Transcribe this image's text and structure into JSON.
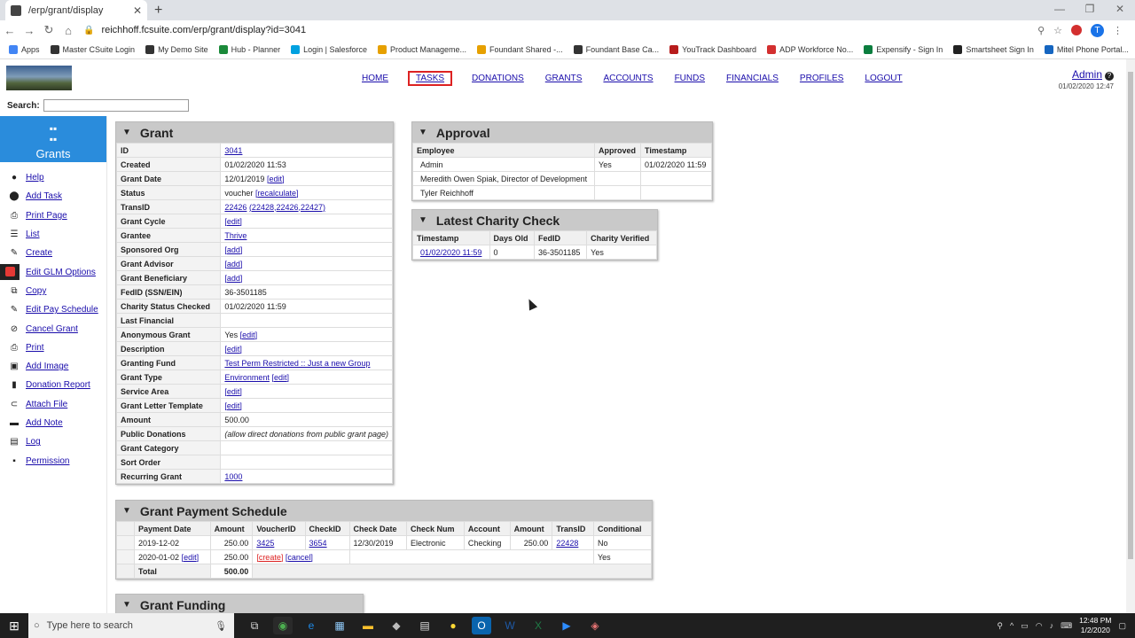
{
  "browser": {
    "tab_title": "/erp/grant/display",
    "url": "reichhoff.fcsuite.com/erp/grant/display?id=3041",
    "profile_initial": "T",
    "bookmarks": [
      "Apps",
      "Master CSuite Login",
      "My Demo Site",
      "Hub - Planner",
      "Login | Salesforce",
      "Product Manageme...",
      "Foundant Shared -...",
      "Foundant Base Ca...",
      "YouTrack Dashboard",
      "ADP Workforce No...",
      "Expensify - Sign In",
      "Smartsheet Sign In",
      "Mitel Phone Portal..."
    ]
  },
  "nav": {
    "items": [
      "HOME",
      "TASKS",
      "DONATIONS",
      "GRANTS",
      "ACCOUNTS",
      "FUNDS",
      "FINANCIALS",
      "PROFILES",
      "LOGOUT"
    ],
    "selected": "TASKS"
  },
  "user": {
    "name": "Admin",
    "datetime": "01/02/2020 12:47"
  },
  "search": {
    "label": "Search:",
    "value": ""
  },
  "sidebar": {
    "title": "Grants",
    "items": [
      {
        "label": "Help",
        "icon": "question-icon"
      },
      {
        "label": "Add Task",
        "icon": "task-icon"
      },
      {
        "label": "Print Page",
        "icon": "printer-icon"
      },
      {
        "label": "List",
        "icon": "list-icon"
      },
      {
        "label": "Create",
        "icon": "pencil-icon"
      },
      {
        "label": "Edit GLM Options",
        "icon": "red-square-icon"
      },
      {
        "label": "Copy",
        "icon": "copy-icon"
      },
      {
        "label": "Edit Pay Schedule",
        "icon": "edit-icon"
      },
      {
        "label": "Cancel Grant",
        "icon": "cancel-icon"
      },
      {
        "label": "Print",
        "icon": "printer-icon"
      },
      {
        "label": "Add Image",
        "icon": "image-icon"
      },
      {
        "label": "Donation Report",
        "icon": "bar-chart-icon"
      },
      {
        "label": "Attach File",
        "icon": "paperclip-icon"
      },
      {
        "label": "Add Note",
        "icon": "note-icon"
      },
      {
        "label": "Log",
        "icon": "log-icon"
      },
      {
        "label": "Permission",
        "icon": "lock-icon"
      }
    ]
  },
  "grant": {
    "title": "Grant",
    "rows": [
      {
        "label": "ID",
        "value": "3041",
        "link": true
      },
      {
        "label": "Created",
        "value": "01/02/2020 11:53"
      },
      {
        "label": "Grant Date",
        "value": "12/01/2019",
        "action": "[edit]"
      },
      {
        "label": "Status",
        "value": "voucher",
        "action": "[recalculate]"
      },
      {
        "label": "TransID",
        "value": "22426",
        "link": true,
        "extra": "(22428,22426,22427)"
      },
      {
        "label": "Grant Cycle",
        "value": "",
        "action": "[edit]"
      },
      {
        "label": "Grantee",
        "value": "Thrive",
        "link": true
      },
      {
        "label": "Sponsored Org",
        "value": "",
        "action": "[add]"
      },
      {
        "label": "Grant Advisor",
        "value": "",
        "action": "[add]"
      },
      {
        "label": "Grant Beneficiary",
        "value": "",
        "action": "[add]"
      },
      {
        "label": "FedID (SSN/EIN)",
        "value": "36-3501185"
      },
      {
        "label": "Charity Status Checked",
        "value": "01/02/2020 11:59"
      },
      {
        "label": "Last Financial",
        "value": ""
      },
      {
        "label": "Anonymous Grant",
        "value": "Yes",
        "action": "[edit]"
      },
      {
        "label": "Description",
        "value": "",
        "action": "[edit]"
      },
      {
        "label": "Granting Fund",
        "value": "Test Perm Restricted :: Just a new Group",
        "link": true
      },
      {
        "label": "Grant Type",
        "value": "Environment",
        "link": true,
        "action": "[edit]"
      },
      {
        "label": "Service Area",
        "value": "",
        "action": "[edit]"
      },
      {
        "label": "Grant Letter Template",
        "value": "",
        "action": "[edit]"
      },
      {
        "label": "Amount",
        "value": "500.00"
      },
      {
        "label": "Public Donations",
        "value": "(allow direct donations from public grant page)",
        "italic": true
      },
      {
        "label": "Grant Category",
        "value": ""
      },
      {
        "label": "Sort Order",
        "value": ""
      },
      {
        "label": "Recurring Grant",
        "value": "1000",
        "link": true
      }
    ]
  },
  "approval": {
    "title": "Approval",
    "headers": [
      "Employee",
      "Approved",
      "Timestamp"
    ],
    "rows": [
      [
        "Admin",
        "Yes",
        "01/02/2020 11:59"
      ],
      [
        "Meredith Owen Spiak, Director of Development",
        "",
        ""
      ],
      [
        "Tyler Reichhoff",
        "",
        ""
      ]
    ]
  },
  "charity": {
    "title": "Latest Charity Check",
    "headers": [
      "Timestamp",
      "Days Old",
      "FedID",
      "Charity Verified"
    ],
    "rows": [
      [
        "01/02/2020 11:59",
        "0",
        "36-3501185",
        "Yes"
      ]
    ]
  },
  "schedule": {
    "title": "Grant Payment Schedule",
    "headers": [
      "Payment Date",
      "Amount",
      "VoucherID",
      "CheckID",
      "Check Date",
      "Check Num",
      "Account",
      "Amount",
      "TransID",
      "Conditional"
    ],
    "rows": [
      {
        "date": "2019-12-02",
        "amount": "250.00",
        "voucher": "3425",
        "check": "3654",
        "check_date": "12/30/2019",
        "check_num": "Electronic",
        "account": "Checking",
        "amount2": "250.00",
        "trans": "22428",
        "conditional": "No"
      },
      {
        "date": "2020-01-02",
        "date_action": "[edit]",
        "amount": "250.00",
        "create": "[create]",
        "cancel": "[cancel]",
        "conditional": "Yes"
      }
    ],
    "total_label": "Total",
    "total_value": "500.00"
  },
  "funding": {
    "title": "Grant Funding"
  },
  "taskbar": {
    "search_placeholder": "Type here to search",
    "time": "12:48 PM",
    "date": "1/2/2020"
  }
}
